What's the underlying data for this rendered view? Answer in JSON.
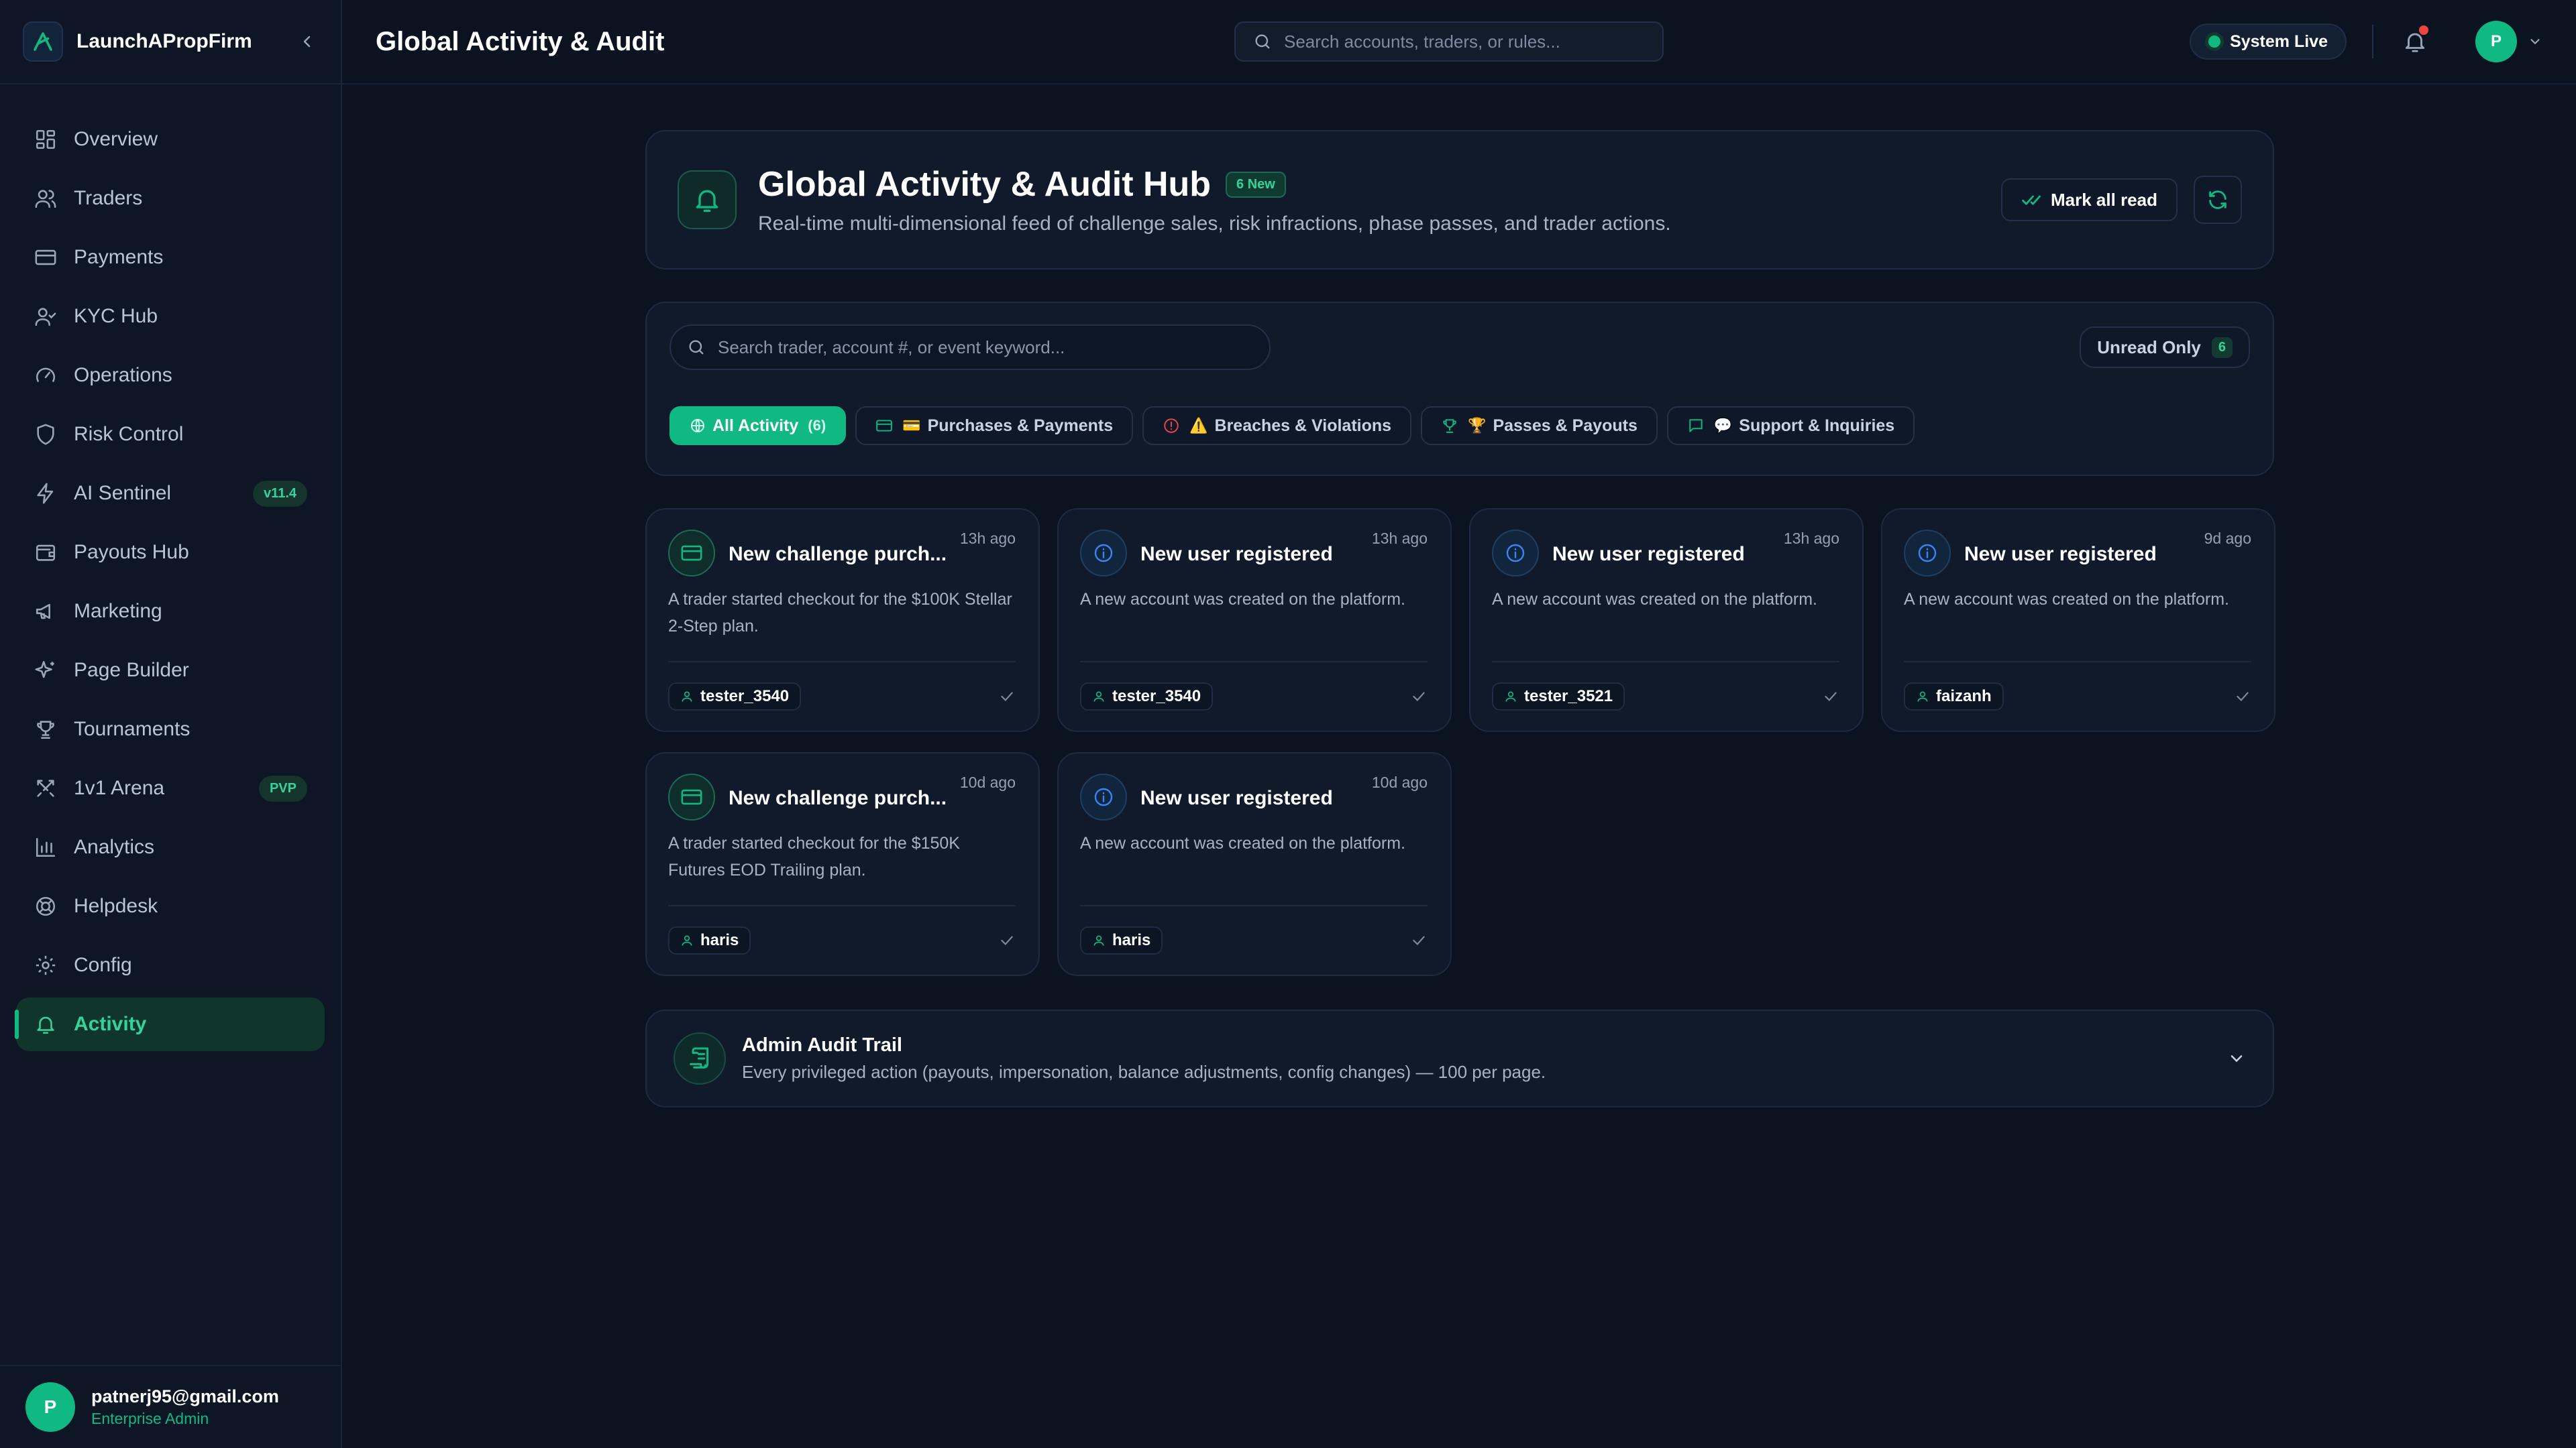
{
  "brand": {
    "name": "LaunchAPropFirm"
  },
  "colors": {
    "accent": "#10b981",
    "background": "#0b1220",
    "panel": "#101a2b",
    "danger": "#ef4444"
  },
  "sidebar": {
    "items": [
      {
        "label": "Overview",
        "icon": "grid-icon"
      },
      {
        "label": "Traders",
        "icon": "users-icon"
      },
      {
        "label": "Payments",
        "icon": "credit-card-icon"
      },
      {
        "label": "KYC Hub",
        "icon": "user-check-icon"
      },
      {
        "label": "Operations",
        "icon": "gauge-icon"
      },
      {
        "label": "Risk Control",
        "icon": "shield-icon"
      },
      {
        "label": "AI Sentinel",
        "icon": "zap-icon",
        "badge": "v11.4"
      },
      {
        "label": "Payouts Hub",
        "icon": "wallet-icon"
      },
      {
        "label": "Marketing",
        "icon": "megaphone-icon"
      },
      {
        "label": "Page Builder",
        "icon": "sparkles-icon"
      },
      {
        "label": "Tournaments",
        "icon": "trophy-icon"
      },
      {
        "label": "1v1 Arena",
        "icon": "swords-icon",
        "badge": "PVP"
      },
      {
        "label": "Analytics",
        "icon": "bar-chart-icon"
      },
      {
        "label": "Helpdesk",
        "icon": "lifebuoy-icon"
      },
      {
        "label": "Config",
        "icon": "gear-icon"
      },
      {
        "label": "Activity",
        "icon": "bell-icon",
        "active": true
      }
    ]
  },
  "user": {
    "email": "patnerj95@gmail.com",
    "role": "Enterprise Admin",
    "initial": "P"
  },
  "header": {
    "title": "Global Activity & Audit",
    "search_placeholder": "Search accounts, traders, or rules...",
    "status": "System Live",
    "avatar_initial": "P"
  },
  "hero": {
    "title": "Global Activity & Audit Hub",
    "badge": "6 New",
    "subtitle": "Real-time multi-dimensional feed of challenge sales, risk infractions, phase passes, and trader actions.",
    "mark_all_read": "Mark all read"
  },
  "filters": {
    "search_placeholder": "Search trader, account #, or event keyword...",
    "unread_label": "Unread Only",
    "unread_count": "6",
    "chips": [
      {
        "label": "All Activity",
        "count": "(6)",
        "active": true
      },
      {
        "label": "Purchases & Payments",
        "emoji": "💳"
      },
      {
        "label": "Breaches & Violations",
        "emoji": "⚠️"
      },
      {
        "label": "Passes & Payouts",
        "emoji": "🏆"
      },
      {
        "label": "Support & Inquiries",
        "emoji": "💬"
      }
    ]
  },
  "feed": [
    {
      "type": "purchase",
      "title": "New challenge purch...",
      "time": "13h ago",
      "desc": "A trader started checkout for the $100K Stellar 2-Step plan.",
      "user": "tester_3540"
    },
    {
      "type": "user",
      "title": "New user registered",
      "time": "13h ago",
      "desc": "A new account was created on the platform.",
      "user": "tester_3540"
    },
    {
      "type": "user",
      "title": "New user registered",
      "time": "13h ago",
      "desc": "A new account was created on the platform.",
      "user": "tester_3521"
    },
    {
      "type": "user",
      "title": "New user registered",
      "time": "9d ago",
      "desc": "A new account was created on the platform.",
      "user": "faizanh"
    },
    {
      "type": "purchase",
      "title": "New challenge purch...",
      "time": "10d ago",
      "desc": "A trader started checkout for the $150K Futures EOD Trailing plan.",
      "user": "haris"
    },
    {
      "type": "user",
      "title": "New user registered",
      "time": "10d ago",
      "desc": "A new account was created on the platform.",
      "user": "haris"
    }
  ],
  "audit": {
    "title": "Admin Audit Trail",
    "subtitle": "Every privileged action (payouts, impersonation, balance adjustments, config changes) — 100 per page."
  }
}
